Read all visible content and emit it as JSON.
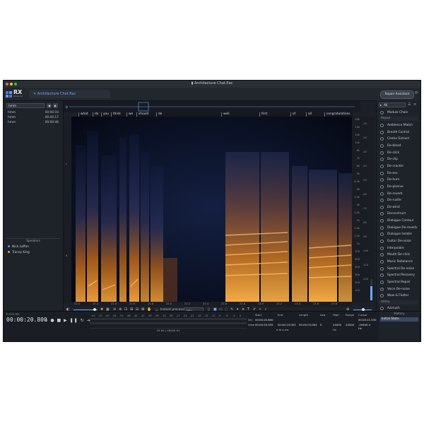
{
  "window": {
    "title": "Architecture Chat.flac"
  },
  "app": {
    "logo_text": "RX",
    "logo_sub": "Advanced"
  },
  "tabbar": {
    "tab_label": "Architecture Chat.flac",
    "repair_assistant": "Repair Assistant"
  },
  "markers": {
    "search_value": "hmm",
    "rows": [
      {
        "name": "hmm",
        "time": "00:00:10"
      },
      {
        "name": "hmm",
        "time": "00:00:17"
      },
      {
        "name": "hmm",
        "time": "00:00:46"
      }
    ]
  },
  "speakers": {
    "heading": "Speakers",
    "items": [
      {
        "name": "Nick Laffen",
        "color": "#5b8ff0"
      },
      {
        "name": "Tracey King",
        "color": "#e6a13a"
      }
    ]
  },
  "transcript": {
    "words": [
      "what",
      "do",
      "you",
      "think",
      "we",
      "should",
      "do",
      "well",
      "first",
      "of",
      "all",
      "congratulations"
    ]
  },
  "axes": {
    "freq_ticks": [
      "20k",
      "15k",
      "12k",
      "10k",
      "8k",
      "7k",
      "6k",
      "5k",
      "4.5k",
      "4k",
      "3.5k",
      "3k",
      "2.5k",
      "2k",
      "1.5k",
      "1.2k",
      "1k",
      "700",
      "500",
      "400",
      "300",
      "200",
      "100"
    ],
    "db_ticks": [
      "-10",
      "-20",
      "-30",
      "-40",
      "-50",
      "-60",
      "-70",
      "-80",
      "-90",
      "-100",
      "-110",
      "-120"
    ],
    "time_ticks": [
      "21.0",
      "21.2",
      "21.4",
      "21.6",
      "21.8",
      "22.0",
      "22.2",
      "22.4",
      "22.6",
      "22.8",
      "23.0",
      "23.2",
      "23.4",
      "23.6",
      "23.8"
    ]
  },
  "toolbar": {
    "instant_process": "Instant process",
    "mode": "Gain"
  },
  "modules": {
    "filter": "All",
    "module_chain": "Module Chain",
    "repair_section": "Repair",
    "repair": [
      "Ambience Match",
      "Breath Control",
      "Center Extract",
      "De-bleed",
      "De-click",
      "De-clip",
      "De-crackle",
      "De-ess",
      "De-hum",
      "De-plosive",
      "De-reverb",
      "De-rustle",
      "De-wind",
      "Deconstruct",
      "Dialogue Contour",
      "Dialogue De-reverb",
      "Dialogue Isolate",
      "Guitar De-noise",
      "Interpolate",
      "Mouth De-click",
      "Music Rebalance",
      "Spectral De-noise",
      "Spectral Recovery",
      "Spectral Repair",
      "Voice De-noise",
      "Wow & Flutter"
    ],
    "utility_section": "Utility",
    "utility": [
      "Azimuth"
    ]
  },
  "transport": {
    "label": "h:m:s.ms",
    "timecode": "00:00:20.800",
    "format": "24 bit | 48000 Hz"
  },
  "meter": {
    "ticks": [
      "-Inf",
      "-70",
      "-60",
      "-54",
      "-51",
      "-48",
      "-45",
      "-42",
      "-39",
      "-36",
      "-33",
      "-30",
      "-27",
      "-24",
      "-21",
      "-18",
      "-15",
      "-12",
      "-9",
      "-6",
      "-3",
      "0"
    ]
  },
  "selection": {
    "headers": [
      "Start",
      "End",
      "Length",
      "Low",
      "High",
      "Range",
      "Cursor"
    ],
    "sel_label": "Sel",
    "view_label": "View",
    "sel_start": "00:00:20.800",
    "view_start": "00:00:20.939",
    "view_end": "00:00:24.003",
    "view_length": "00:00:03.064",
    "low": "0",
    "high": "24000",
    "range": "24000",
    "cursor_time": "00:00:21.530",
    "cursor_db": "-20645.4 Hz",
    "unit_time": "h:m:s.ms",
    "unit_hz": "Hz"
  },
  "history": {
    "heading": "History",
    "item": "Initial State"
  }
}
